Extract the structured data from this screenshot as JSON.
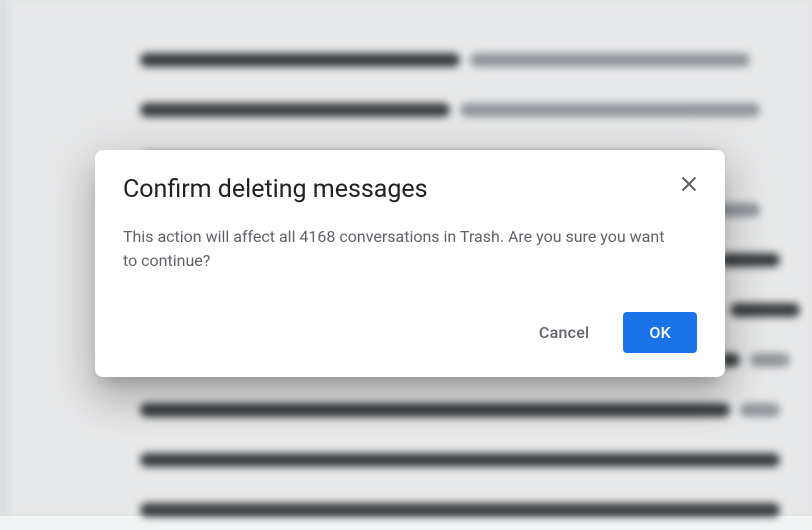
{
  "dialog": {
    "title": "Confirm deleting messages",
    "body": "This action will affect all 4168 conversations in Trash. Are you sure you want to continue?",
    "cancel_label": "Cancel",
    "ok_label": "OK"
  }
}
